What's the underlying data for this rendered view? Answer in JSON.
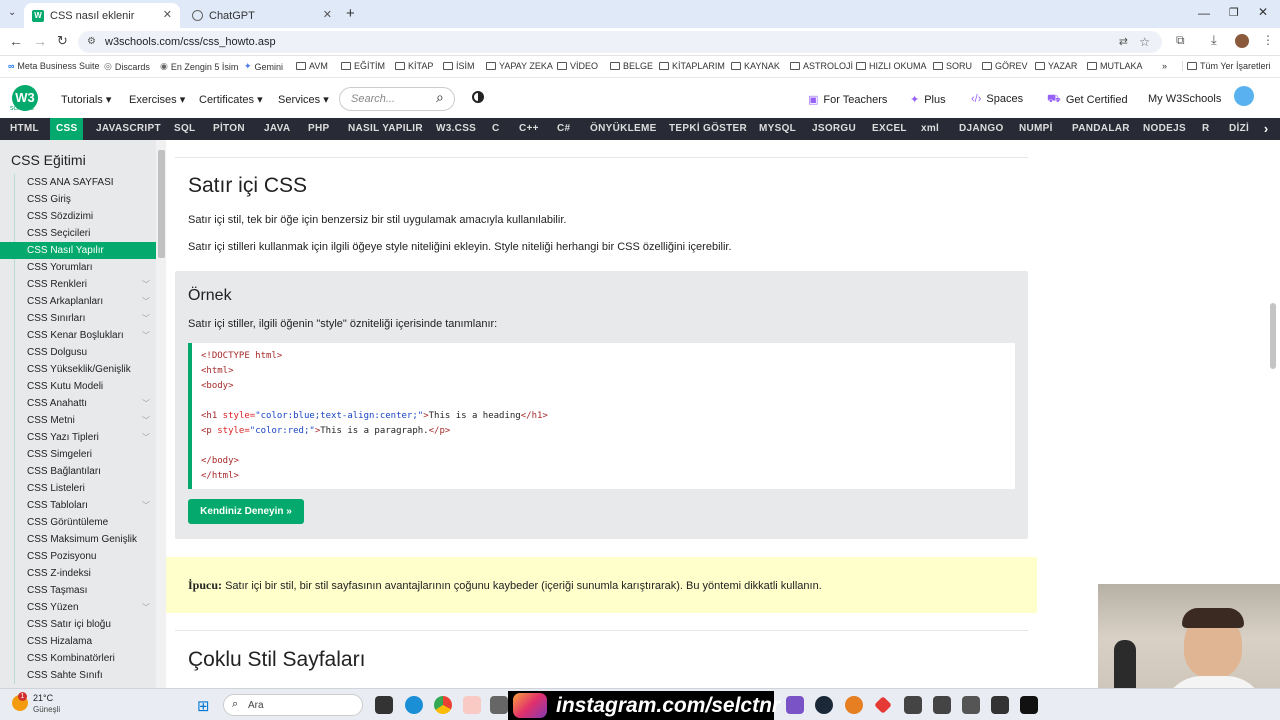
{
  "browser": {
    "tabs": [
      {
        "title": "CSS nasıl eklenir",
        "active": true
      },
      {
        "title": "ChatGPT",
        "active": false
      }
    ],
    "new_tab": "+",
    "url": "w3schools.com/css/css_howto.asp",
    "bookmarks": [
      "Meta Business Suite",
      "Discards",
      "En Zengin 5 İsim",
      "Gemini",
      "AVM",
      "EĞİTİM",
      "KİTAP",
      "İSİM",
      "YAPAY ZEKA",
      "VİDEO",
      "BELGE",
      "KİTAPLARIM",
      "KAYNAK",
      "ASTROLOJİ",
      "HIZLI OKUMA",
      "SORU",
      "GÖREV",
      "YAZAR",
      "MUTLAKA"
    ],
    "bookmarks_more": "»",
    "all_bookmarks": "Tüm Yer İşaretleri"
  },
  "site": {
    "logo": "W3",
    "logo_sub": "schools",
    "menus": [
      "Tutorials",
      "Exercises",
      "Certificates",
      "Services"
    ],
    "search_placeholder": "Search...",
    "right_links": [
      "For Teachers",
      "Plus",
      "Spaces",
      "Get Certified",
      "My W3Schools"
    ],
    "topnav": [
      "HTML",
      "CSS",
      "JAVASCRIPT",
      "SQL",
      "PİTON",
      "JAVA",
      "PHP",
      "NASIL YAPILIR",
      "W3.CSS",
      "C",
      "C++",
      "C#",
      "ÖNYÜKLEME",
      "TEPKİ GÖSTER",
      "MYSQL",
      "JSORGU",
      "EXCEL",
      "xml",
      "DJANGO",
      "NUMPİ",
      "PANDALAR",
      "NODEJS",
      "R",
      "DİZİ"
    ],
    "topnav_active": "CSS"
  },
  "sidebar": {
    "title": "CSS Eğitimi",
    "items": [
      "CSS ANA SAYFASI",
      "CSS Giriş",
      "CSS Sözdizimi",
      "CSS Seçicileri",
      "CSS Nasıl Yapılır",
      "CSS Yorumları",
      "CSS Renkleri",
      "CSS Arkaplanları",
      "CSS Sınırları",
      "CSS Kenar Boşlukları",
      "CSS Dolgusu",
      "CSS Yükseklik/Genişlik",
      "CSS Kutu Modeli",
      "CSS Anahattı",
      "CSS Metni",
      "CSS Yazı Tipleri",
      "CSS Simgeleri",
      "CSS Bağlantıları",
      "CSS Listeleri",
      "CSS Tabloları",
      "CSS Görüntüleme",
      "CSS Maksimum Genişlik",
      "CSS Pozisyonu",
      "CSS Z-indeksi",
      "CSS Taşması",
      "CSS Yüzen",
      "CSS Satır içi bloğu",
      "CSS Hizalama",
      "CSS Kombinatörleri",
      "CSS Sahte Sınıfı"
    ],
    "active": "CSS Nasıl Yapılır"
  },
  "main": {
    "heading": "Satır içi CSS",
    "p1": "Satır içi stil, tek bir öğe için benzersiz bir stil uygulamak amacıyla kullanılabilir.",
    "p2": "Satır içi stilleri kullanmak için ilgili öğeye style niteliğini ekleyin. Style niteliği herhangi bir CSS özelliğini içerebilir.",
    "example": {
      "title": "Örnek",
      "desc": "Satır içi stiller, ilgili öğenin \"style\" özniteliği içerisinde tanımlanır:",
      "code": {
        "doctype": "<!DOCTYPE html>",
        "html_open": "<html>",
        "body_open": "<body>",
        "h1_tag": "<h1",
        "h1_attr": " style=",
        "h1_val": "\"color:blue;text-align:center;\"",
        "h1_close": ">",
        "h1_text": "This is a heading",
        "h1_end": "</h1>",
        "p_tag": "<p",
        "p_attr": " style=",
        "p_val": "\"color:red;\"",
        "p_close": ">",
        "p_text": "This is a paragraph.",
        "p_end": "</p>",
        "body_close": "</body>",
        "html_close": "</html>"
      },
      "button": "Kendiniz Deneyin »"
    },
    "tip_label": "İpucu:",
    "tip_text": " Satır içi bir stil, bir stil sayfasının avantajlarının çoğunu kaybeder (içeriği sunumla karıştırarak). Bu yöntemi dikkatli kullanın.",
    "heading2": "Çoklu Stil Sayfaları"
  },
  "taskbar": {
    "weather_temp": "21°C",
    "weather_desc": "Güneşli",
    "search": "Ara",
    "overlay": "instagram.com/selctnr"
  },
  "colors": {
    "accent": "#04aa6d",
    "topnav": "#282a35",
    "tip": "#ffffcc"
  }
}
